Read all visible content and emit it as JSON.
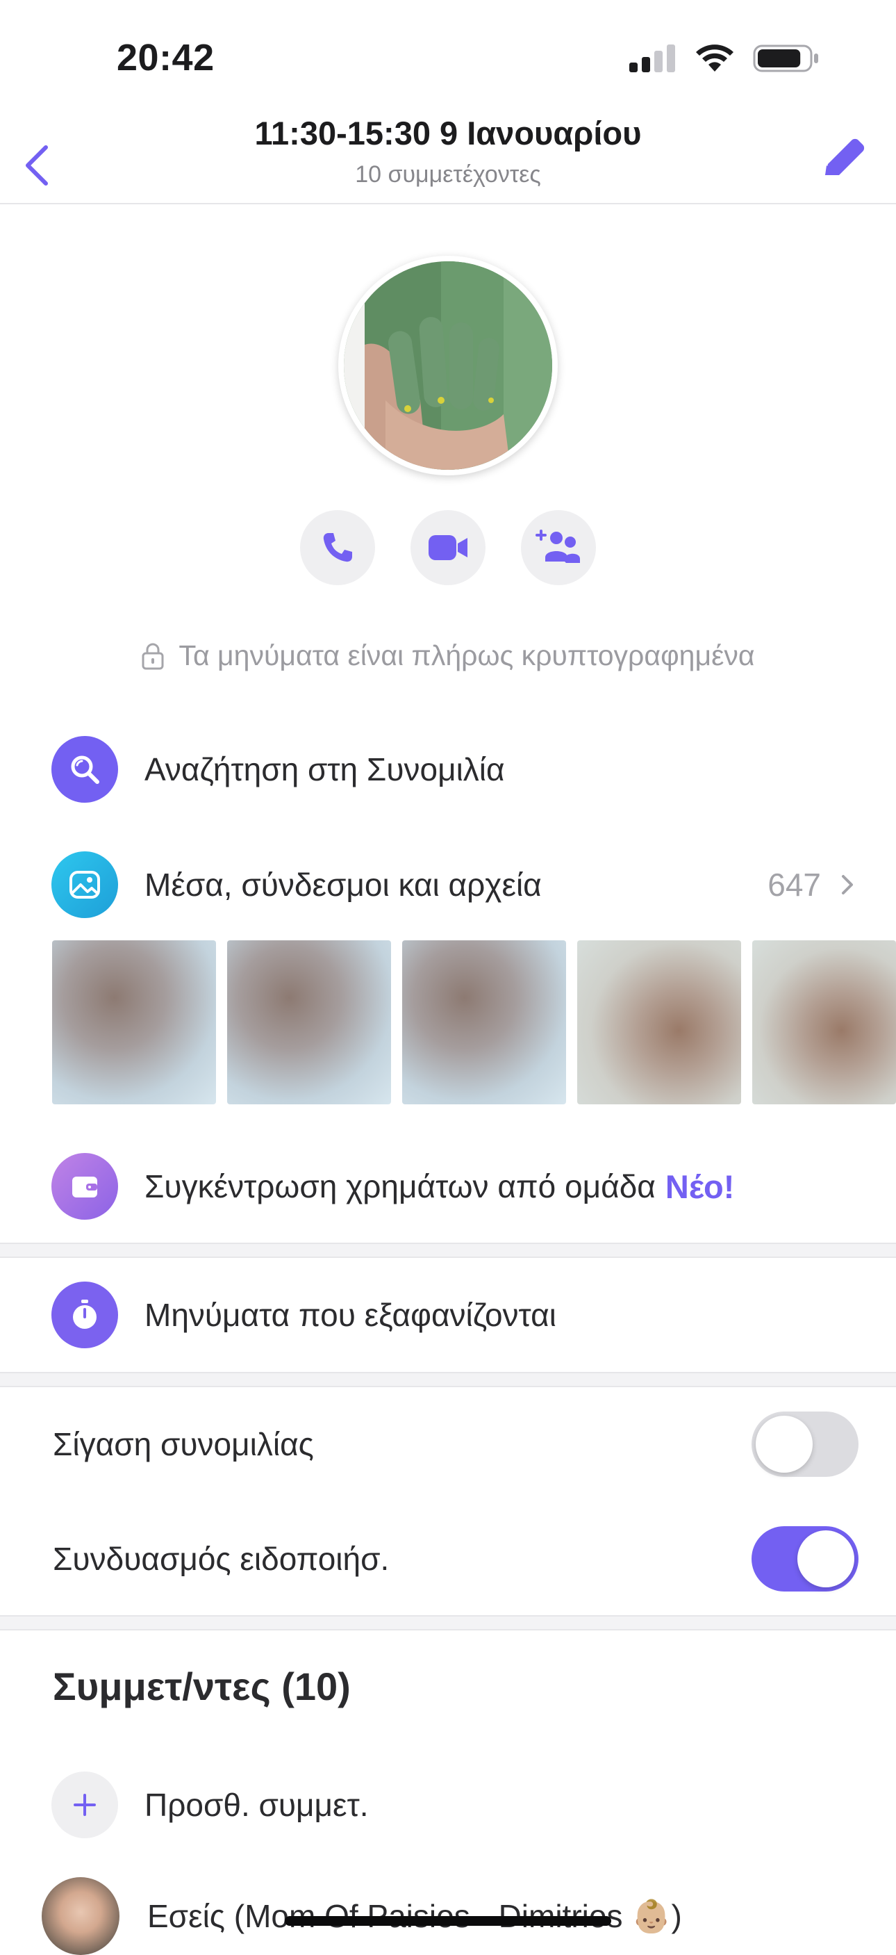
{
  "status_bar": {
    "time": "20:42",
    "battery_level": 0.85
  },
  "header": {
    "title": "11:30-15:30 9 Ιανουαρίου",
    "subtitle": "10 συμμετέχοντες"
  },
  "colors": {
    "accent": "#7360f2",
    "search_icon_bg": "#7360f2",
    "media_icon_bg": "#2fb8e8",
    "money_icon_bg": "#a070e4",
    "disappear_icon_bg": "#7b62ef"
  },
  "encrypted_text": "Τα μηνύματα είναι πλήρως κρυπτογραφημένα",
  "menu": {
    "search_label": "Αναζήτηση στη Συνομιλία",
    "media_label": "Μέσα, σύνδεσμοι και αρχεία",
    "media_count": "647",
    "money_label": "Συγκέντρωση χρημάτων από ομάδα",
    "money_badge": "Νέο!",
    "disappearing_label": "Μηνύματα που εξαφανίζονται"
  },
  "settings": {
    "mute_label": "Σίγαση συνομιλίας",
    "mute_on": false,
    "notif_label": "Συνδυασμός ειδοποιήσ.",
    "notif_on": true
  },
  "participants": {
    "title": "Συμμετ/ντες (10)",
    "add_label": "Προσθ. συμμετ.",
    "self_label": "Εσείς (Mom Of Paisios - Dimitrios 👶🏼)"
  }
}
